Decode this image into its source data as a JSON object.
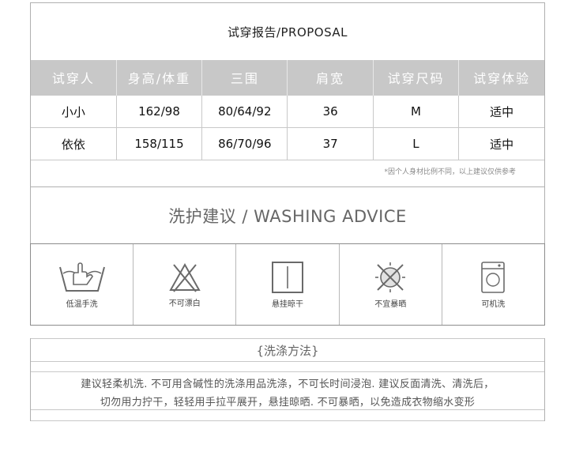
{
  "proposal": {
    "title": "试穿报告/PROPOSAL",
    "headers": [
      "试穿人",
      "身高/体重",
      "三围",
      "肩宽",
      "试穿尺码",
      "试穿体验"
    ],
    "rows": [
      [
        "小小",
        "162/98",
        "80/64/92",
        "36",
        "M",
        "适中"
      ],
      [
        "依依",
        "158/115",
        "86/70/96",
        "37",
        "L",
        "适中"
      ]
    ],
    "note": "*因个人身材比例不同，以上建议仅供参考"
  },
  "washing": {
    "title": "洗护建议 / WASHING ADVICE",
    "icons": [
      {
        "icon": "hand-wash-low-temp-icon",
        "label": "低温手洗"
      },
      {
        "icon": "no-bleach-icon",
        "label": "不可漂白"
      },
      {
        "icon": "hang-dry-icon",
        "label": "悬挂晾干"
      },
      {
        "icon": "no-sun-dry-icon",
        "label": "不宜暴晒"
      },
      {
        "icon": "machine-wash-icon",
        "label": "可机洗"
      }
    ]
  },
  "method": {
    "title": "{洗涤方法}",
    "line1": "建议轻柔机洗. 不可用含碱性的洗涤用品洗涤，不可长时间浸泡. 建议反面清洗、清洗后，",
    "line2": "切勿用力拧干，轻轻用手拉平展开，悬挂晾晒. 不可暴晒，以免造成衣物缩水变形"
  },
  "colors": {
    "header_bg": "#c8c8c8",
    "border": "#b0b0b0",
    "muted_text": "#666666"
  }
}
